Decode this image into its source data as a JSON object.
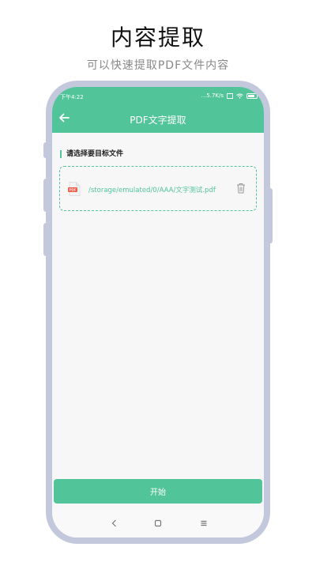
{
  "promo": {
    "title": "内容提取",
    "subtitle": "可以快速提取PDF文件内容"
  },
  "status_bar": {
    "time": "下午4:22",
    "network_speed": "...5.7K/s",
    "battery": "40"
  },
  "app_bar": {
    "title": "PDF文字提取",
    "back_icon": "arrow-left-icon"
  },
  "content": {
    "section_label": "请选择要目标文件",
    "file": {
      "icon": "pdf-file-icon",
      "path": "/storage/emulated/0/AAA/文字测试.pdf",
      "delete_icon": "trash-icon"
    }
  },
  "actions": {
    "start_label": "开始"
  },
  "colors": {
    "accent": "#52c49a",
    "frame": "#c3c8dc",
    "background": "#f7f7f7"
  }
}
